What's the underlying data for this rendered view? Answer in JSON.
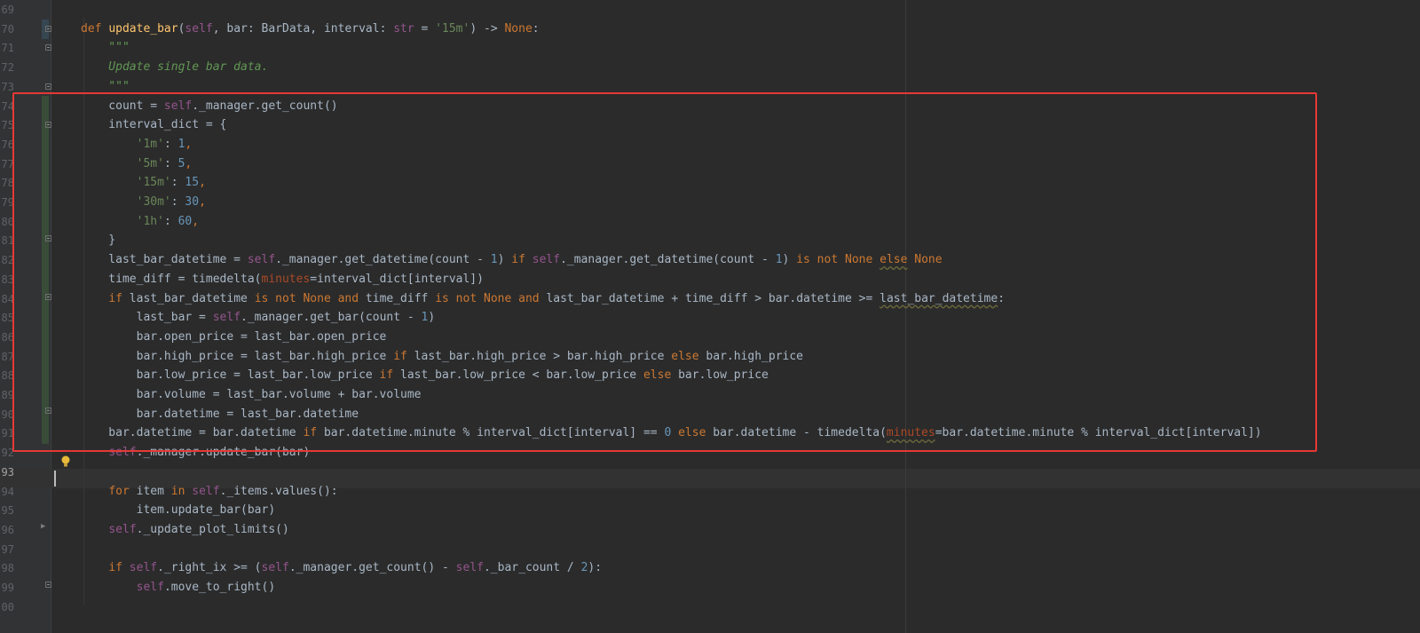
{
  "line_numbers": [
    "69",
    "70",
    "71",
    "72",
    "73",
    "74",
    "75",
    "76",
    "77",
    "78",
    "79",
    "80",
    "81",
    "82",
    "83",
    "84",
    "85",
    "86",
    "87",
    "88",
    "89",
    "90",
    "91",
    "92",
    "93",
    "94",
    "95",
    "96",
    "97",
    "98",
    "99",
    "00"
  ],
  "current_line_index": 24,
  "colors": {
    "background": "#2b2b2b",
    "highlight_box": "#e53935",
    "keyword": "#cc7832",
    "function": "#ffc66d",
    "self": "#94558d",
    "string": "#6a8759",
    "number": "#6897bb"
  },
  "code_lines": [
    {
      "tokens": []
    },
    {
      "tokens": [
        {
          "t": "def ",
          "c": "kw"
        },
        {
          "t": "update_bar",
          "c": "fn"
        },
        {
          "t": "(",
          "c": "plain"
        },
        {
          "t": "self",
          "c": "self"
        },
        {
          "t": ", bar: BarData, interval: ",
          "c": "plain"
        },
        {
          "t": "str",
          "c": "self"
        },
        {
          "t": " = ",
          "c": "plain"
        },
        {
          "t": "'15m'",
          "c": "str"
        },
        {
          "t": ") -> ",
          "c": "plain"
        },
        {
          "t": "None",
          "c": "kw"
        },
        {
          "t": ":",
          "c": "plain"
        }
      ]
    },
    {
      "tokens": [
        {
          "t": "    \"\"\"",
          "c": "doc"
        }
      ]
    },
    {
      "tokens": [
        {
          "t": "    Update single bar data.",
          "c": "doc"
        }
      ]
    },
    {
      "tokens": [
        {
          "t": "    \"\"\"",
          "c": "doc"
        }
      ]
    },
    {
      "tokens": [
        {
          "t": "    count = ",
          "c": "plain"
        },
        {
          "t": "self",
          "c": "self"
        },
        {
          "t": "._manager.get_count()",
          "c": "plain"
        }
      ]
    },
    {
      "tokens": [
        {
          "t": "    interval_dict = {",
          "c": "plain"
        }
      ]
    },
    {
      "tokens": [
        {
          "t": "        ",
          "c": "plain"
        },
        {
          "t": "'1m'",
          "c": "str"
        },
        {
          "t": ": ",
          "c": "plain"
        },
        {
          "t": "1",
          "c": "num"
        },
        {
          "t": ",",
          "c": "kw"
        }
      ]
    },
    {
      "tokens": [
        {
          "t": "        ",
          "c": "plain"
        },
        {
          "t": "'5m'",
          "c": "str"
        },
        {
          "t": ": ",
          "c": "plain"
        },
        {
          "t": "5",
          "c": "num"
        },
        {
          "t": ",",
          "c": "kw"
        }
      ]
    },
    {
      "tokens": [
        {
          "t": "        ",
          "c": "plain"
        },
        {
          "t": "'15m'",
          "c": "str"
        },
        {
          "t": ": ",
          "c": "plain"
        },
        {
          "t": "15",
          "c": "num"
        },
        {
          "t": ",",
          "c": "kw"
        }
      ]
    },
    {
      "tokens": [
        {
          "t": "        ",
          "c": "plain"
        },
        {
          "t": "'30m'",
          "c": "str"
        },
        {
          "t": ": ",
          "c": "plain"
        },
        {
          "t": "30",
          "c": "num"
        },
        {
          "t": ",",
          "c": "kw"
        }
      ]
    },
    {
      "tokens": [
        {
          "t": "        ",
          "c": "plain"
        },
        {
          "t": "'1h'",
          "c": "str"
        },
        {
          "t": ": ",
          "c": "plain"
        },
        {
          "t": "60",
          "c": "num"
        },
        {
          "t": ",",
          "c": "kw"
        }
      ]
    },
    {
      "tokens": [
        {
          "t": "    }",
          "c": "plain"
        }
      ]
    },
    {
      "tokens": [
        {
          "t": "    last_bar_datetime = ",
          "c": "plain"
        },
        {
          "t": "self",
          "c": "self"
        },
        {
          "t": "._manager.get_datetime(count - ",
          "c": "plain"
        },
        {
          "t": "1",
          "c": "num"
        },
        {
          "t": ") ",
          "c": "plain"
        },
        {
          "t": "if ",
          "c": "kw"
        },
        {
          "t": "self",
          "c": "self"
        },
        {
          "t": "._manager.get_datetime(count - ",
          "c": "plain"
        },
        {
          "t": "1",
          "c": "num"
        },
        {
          "t": ") ",
          "c": "plain"
        },
        {
          "t": "is not None ",
          "c": "kw"
        },
        {
          "t": "else",
          "c": "kw sq"
        },
        {
          "t": " None",
          "c": "kw"
        }
      ]
    },
    {
      "tokens": [
        {
          "t": "    time_diff = timedelta(",
          "c": "plain"
        },
        {
          "t": "minutes",
          "c": "param"
        },
        {
          "t": "=interval_dict[interval])",
          "c": "plain"
        }
      ]
    },
    {
      "tokens": [
        {
          "t": "    ",
          "c": "plain"
        },
        {
          "t": "if ",
          "c": "kw"
        },
        {
          "t": "last_bar_datetime ",
          "c": "plain"
        },
        {
          "t": "is not None and ",
          "c": "kw"
        },
        {
          "t": "time_diff ",
          "c": "plain"
        },
        {
          "t": "is not None and ",
          "c": "kw"
        },
        {
          "t": "last_bar_datetime + time_diff > bar.datetime >= ",
          "c": "plain"
        },
        {
          "t": "last_bar_datetime",
          "c": "plain sq"
        },
        {
          "t": ":",
          "c": "plain"
        }
      ]
    },
    {
      "tokens": [
        {
          "t": "        last_bar = ",
          "c": "plain"
        },
        {
          "t": "self",
          "c": "self"
        },
        {
          "t": "._manager.get_bar(count - ",
          "c": "plain"
        },
        {
          "t": "1",
          "c": "num"
        },
        {
          "t": ")",
          "c": "plain"
        }
      ]
    },
    {
      "tokens": [
        {
          "t": "        bar.open_price = last_bar.open_price",
          "c": "plain"
        }
      ]
    },
    {
      "tokens": [
        {
          "t": "        bar.high_price = last_bar.high_price ",
          "c": "plain"
        },
        {
          "t": "if ",
          "c": "kw"
        },
        {
          "t": "last_bar.high_price > bar.high_price ",
          "c": "plain"
        },
        {
          "t": "else ",
          "c": "kw"
        },
        {
          "t": "bar.high_price",
          "c": "plain"
        }
      ]
    },
    {
      "tokens": [
        {
          "t": "        bar.low_price = last_bar.low_price ",
          "c": "plain"
        },
        {
          "t": "if ",
          "c": "kw"
        },
        {
          "t": "last_bar.low_price < bar.low_price ",
          "c": "plain"
        },
        {
          "t": "else ",
          "c": "kw"
        },
        {
          "t": "bar.low_price",
          "c": "plain"
        }
      ]
    },
    {
      "tokens": [
        {
          "t": "        bar.volume = last_bar.volume + bar.volume",
          "c": "plain"
        }
      ]
    },
    {
      "tokens": [
        {
          "t": "        bar.datetime = last_bar.datetime",
          "c": "plain"
        }
      ]
    },
    {
      "tokens": [
        {
          "t": "    bar.datetime = bar.datetime ",
          "c": "plain"
        },
        {
          "t": "if ",
          "c": "kw"
        },
        {
          "t": "bar.datetime.minute % interval_dict[interval] == ",
          "c": "plain"
        },
        {
          "t": "0 ",
          "c": "num"
        },
        {
          "t": "else ",
          "c": "kw"
        },
        {
          "t": "bar.datetime - timedelta(",
          "c": "plain"
        },
        {
          "t": "minutes",
          "c": "param sq"
        },
        {
          "t": "=bar.datetime.minute % interval_dict[interval])",
          "c": "plain"
        }
      ]
    },
    {
      "tokens": [
        {
          "t": "    ",
          "c": "plain"
        },
        {
          "t": "self",
          "c": "self"
        },
        {
          "t": "._manager.update_bar(bar)",
          "c": "plain"
        }
      ]
    },
    {
      "tokens": []
    },
    {
      "tokens": [
        {
          "t": "    ",
          "c": "plain"
        },
        {
          "t": "for ",
          "c": "kw"
        },
        {
          "t": "item ",
          "c": "plain"
        },
        {
          "t": "in ",
          "c": "kw"
        },
        {
          "t": "self",
          "c": "self"
        },
        {
          "t": "._items.values():",
          "c": "plain"
        }
      ]
    },
    {
      "tokens": [
        {
          "t": "        item.update_bar(bar)",
          "c": "plain"
        }
      ]
    },
    {
      "tokens": [
        {
          "t": "    ",
          "c": "plain"
        },
        {
          "t": "self",
          "c": "self"
        },
        {
          "t": "._update_plot_limits()",
          "c": "plain"
        }
      ]
    },
    {
      "tokens": []
    },
    {
      "tokens": [
        {
          "t": "    ",
          "c": "plain"
        },
        {
          "t": "if ",
          "c": "kw"
        },
        {
          "t": "self",
          "c": "self"
        },
        {
          "t": "._right_ix >= (",
          "c": "plain"
        },
        {
          "t": "self",
          "c": "self"
        },
        {
          "t": "._manager.get_count() - ",
          "c": "plain"
        },
        {
          "t": "self",
          "c": "self"
        },
        {
          "t": "._bar_count / ",
          "c": "plain"
        },
        {
          "t": "2",
          "c": "num"
        },
        {
          "t": "):",
          "c": "plain"
        }
      ]
    },
    {
      "tokens": [
        {
          "t": "        ",
          "c": "plain"
        },
        {
          "t": "self",
          "c": "self"
        },
        {
          "t": ".move_to_right()",
          "c": "plain"
        }
      ]
    },
    {
      "tokens": []
    }
  ]
}
